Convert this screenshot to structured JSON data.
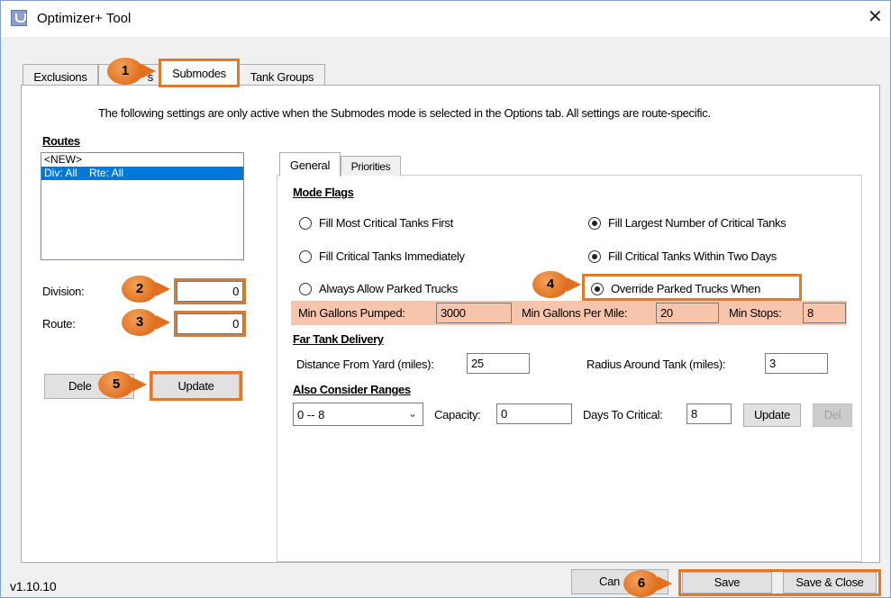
{
  "window": {
    "title": "Optimizer+ Tool",
    "close_glyph": "✕"
  },
  "tabs": {
    "exclusions": "Exclusions",
    "partial_hidden": "s",
    "submodes": "Submodes",
    "tank_groups": "Tank Groups"
  },
  "info_text": "The following settings are only active when the Submodes mode is selected in the Options tab.  All settings are route-specific.",
  "routes": {
    "heading": "Routes",
    "items": [
      "<NEW>",
      "Div: All    Rte: All"
    ],
    "division_label": "Division:",
    "division_value": "0",
    "route_label": "Route:",
    "route_value": "0",
    "delete_label": "Dele",
    "update_label": "Update"
  },
  "inner_tabs": {
    "general": "General",
    "priorities": "Priorities"
  },
  "mode_flags": {
    "heading": "Mode Flags",
    "options": [
      {
        "label": "Fill Most Critical Tanks First",
        "checked": false
      },
      {
        "label": "Fill Largest Number of Critical Tanks",
        "checked": true
      },
      {
        "label": "Fill Critical Tanks Immediately",
        "checked": false
      },
      {
        "label": "Fill Critical Tanks Within Two Days",
        "checked": true
      },
      {
        "label": "Always Allow Parked Trucks",
        "checked": false
      },
      {
        "label": "Override Parked Trucks When",
        "checked": true
      }
    ]
  },
  "override": {
    "min_gallons_pumped_label": "Min Gallons Pumped:",
    "min_gallons_pumped_value": "3000",
    "min_gallons_per_mile_label": "Min Gallons Per Mile:",
    "min_gallons_per_mile_value": "20",
    "min_stops_label": "Min Stops:",
    "min_stops_value": "8"
  },
  "far_tank": {
    "heading": "Far Tank Delivery",
    "distance_label": "Distance From Yard (miles):",
    "distance_value": "25",
    "radius_label": "Radius Around Tank (miles):",
    "radius_value": "3"
  },
  "ranges": {
    "heading": "Also Consider Ranges",
    "selected_range": "0 -- 8",
    "capacity_label": "Capacity:",
    "capacity_value": "0",
    "days_label": "Days To Critical:",
    "days_value": "8",
    "update_label": "Update",
    "del_label": "Del"
  },
  "footer": {
    "version": "v1.10.10",
    "cancel_label": "Can",
    "save_label": "Save",
    "save_close_label": "Save & Close"
  },
  "callouts": [
    "1",
    "2",
    "3",
    "4",
    "5",
    "6"
  ],
  "colors": {
    "callout": "#e0701f",
    "highlight": "#f7c5ab",
    "selection": "#0078d7"
  }
}
